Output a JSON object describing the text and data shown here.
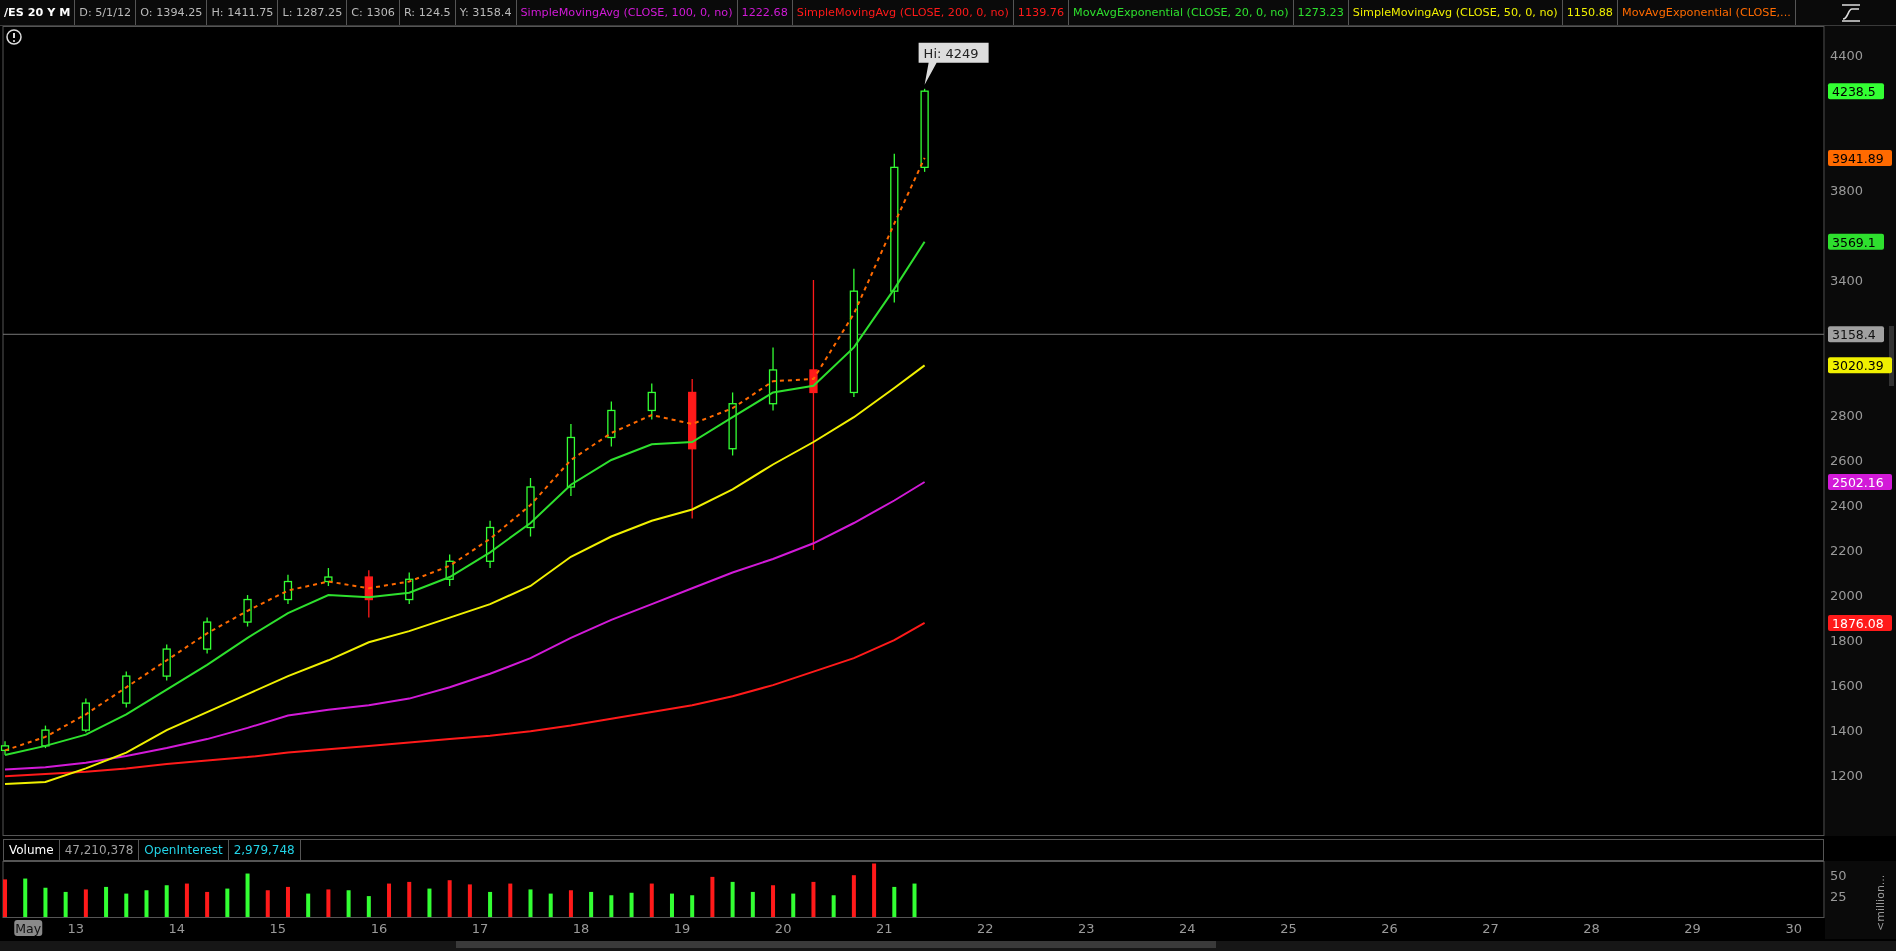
{
  "header": {
    "symbol": "/ES 20 Y M",
    "fields": [
      "D: 5/1/12",
      "O: 1394.25",
      "H: 1411.75",
      "L: 1287.25",
      "C: 1306",
      "R: 124.5",
      "Y: 3158.4"
    ],
    "study_values": [
      "1222.68",
      "1139.76",
      "1273.23",
      "1150.88"
    ]
  },
  "price_chart": {
    "candles": {
      "chart_data": {
        "type": "candlestick",
        "x": [
          12.3,
          12.7,
          13.1,
          13.5,
          13.9,
          14.3,
          14.7,
          15.1,
          15.5,
          15.9,
          16.3,
          16.7,
          17.1,
          17.5,
          17.9,
          18.3,
          18.7,
          19.1,
          19.5,
          19.9,
          20.3,
          20.7,
          21.1,
          21.4
        ],
        "ohlc": [
          [
            1310,
            1350,
            1290,
            1330
          ],
          [
            1330,
            1420,
            1320,
            1400
          ],
          [
            1400,
            1540,
            1390,
            1520
          ],
          [
            1520,
            1660,
            1500,
            1640
          ],
          [
            1640,
            1780,
            1620,
            1760
          ],
          [
            1760,
            1900,
            1740,
            1880
          ],
          [
            1880,
            2000,
            1860,
            1980
          ],
          [
            1980,
            2090,
            1960,
            2060
          ],
          [
            2060,
            2120,
            2040,
            2080
          ],
          [
            2080,
            2110,
            1900,
            1980
          ],
          [
            1980,
            2100,
            1960,
            2070
          ],
          [
            2070,
            2180,
            2040,
            2150
          ],
          [
            2150,
            2330,
            2120,
            2300
          ],
          [
            2300,
            2520,
            2260,
            2480
          ],
          [
            2480,
            2760,
            2440,
            2700
          ],
          [
            2700,
            2860,
            2660,
            2820
          ],
          [
            2820,
            2940,
            2780,
            2900
          ],
          [
            2900,
            2960,
            2340,
            2650
          ],
          [
            2650,
            2900,
            2620,
            2850
          ],
          [
            2850,
            3100,
            2820,
            3000
          ],
          [
            3000,
            3400,
            2200,
            2900
          ],
          [
            2900,
            3450,
            2880,
            3350
          ],
          [
            3350,
            3960,
            3300,
            3900
          ],
          [
            3900,
            4249,
            3880,
            4238.5
          ]
        ],
        "xlim": [
          12.28,
          30.3
        ],
        "ylim": [
          934,
          4528
        ],
        "yticks": [
          1200,
          1400,
          1600,
          1800,
          2000,
          2200,
          2400,
          2600,
          2800,
          3400,
          3800,
          4400
        ],
        "ref_lines": [
          {
            "axis": "y",
            "value": 3158.4,
            "label": "3158.4"
          }
        ],
        "annotations": [
          {
            "x": 21.4,
            "y": 4249,
            "text": "Hi: 4249"
          },
          "4238.5"
        ]
      }
    },
    "averages": {
      "chart_data": {
        "type": "line",
        "x": [
          12.3,
          12.7,
          13.1,
          13.5,
          13.9,
          14.3,
          14.7,
          15.1,
          15.5,
          15.9,
          16.3,
          16.7,
          17.1,
          17.5,
          17.9,
          18.3,
          18.7,
          19.1,
          19.5,
          19.9,
          20.3,
          20.7,
          21.1,
          21.4
        ],
        "series": [
          {
            "name": "SimpleMovingAvg (CLOSE, 100, 0, no)",
            "color": "#d21ad8",
            "line_style": "solid",
            "values": [
              1225,
              1235,
              1255,
              1285,
              1320,
              1360,
              1410,
              1465,
              1490,
              1510,
              1540,
              1590,
              1650,
              1720,
              1810,
              1890,
              1960,
              2030,
              2100,
              2160,
              2230,
              2320,
              2420,
              2502.16
            ]
          },
          {
            "name": "SimpleMovingAvg (CLOSE, 200, 0, no)",
            "color": "#ff1a1a",
            "line_style": "solid",
            "values": [
              1195,
              1205,
              1215,
              1230,
              1250,
              1265,
              1280,
              1300,
              1315,
              1330,
              1345,
              1360,
              1375,
              1395,
              1420,
              1450,
              1480,
              1510,
              1550,
              1600,
              1660,
              1720,
              1800,
              1876.08
            ]
          },
          {
            "name": "MovAvgExponential (CLOSE, 20, 0, no)",
            "color": "#2ee02e",
            "line_style": "solid",
            "values": [
              1290,
              1330,
              1380,
              1470,
              1580,
              1690,
              1810,
              1920,
              2000,
              1990,
              2010,
              2080,
              2190,
              2320,
              2490,
              2600,
              2670,
              2680,
              2790,
              2900,
              2930,
              3100,
              3360,
              3569.1
            ]
          },
          {
            "name": "SimpleMovingAvg (CLOSE, 50, 0, no)",
            "color": "#f0f000",
            "line_style": "solid",
            "values": [
              1160,
              1170,
              1230,
              1300,
              1400,
              1480,
              1560,
              1640,
              1710,
              1790,
              1840,
              1900,
              1960,
              2040,
              2170,
              2260,
              2330,
              2380,
              2470,
              2580,
              2680,
              2790,
              2920,
              3020.39
            ]
          },
          {
            "name": "MovAvgExponential (CLOSE,...",
            "color": "#ff6a00",
            "line_style": "dashed",
            "values": [
              1310,
              1370,
              1470,
              1590,
              1710,
              1830,
              1930,
              2020,
              2060,
              2030,
              2060,
              2130,
              2250,
              2400,
              2600,
              2720,
              2800,
              2760,
              2830,
              2950,
              2960,
              3250,
              3650,
              3941.89
            ]
          }
        ],
        "xlim": [
          12.28,
          30.3
        ],
        "ylim": [
          934,
          4528
        ],
        "annotations": [
          "2502.16",
          "1876.08",
          "3569.1",
          "3020.39",
          "3941.89"
        ]
      }
    }
  },
  "volume_pane": {
    "fields": [
      {
        "text": "Volume",
        "color": "#ffffff"
      },
      {
        "text": "47,210,378",
        "color": "#a0a0a0"
      },
      {
        "text": "OpenInterest",
        "color": "#22d3e6"
      },
      {
        "text": "2,979,748",
        "color": "#22d3e6"
      }
    ],
    "chart_data": {
      "type": "bar",
      "stacked": true,
      "x": [
        12.3,
        12.5,
        12.7,
        12.9,
        13.1,
        13.3,
        13.5,
        13.7,
        13.9,
        14.1,
        14.3,
        14.5,
        14.7,
        14.9,
        15.1,
        15.3,
        15.5,
        15.7,
        15.9,
        16.1,
        16.3,
        16.5,
        16.7,
        16.9,
        17.1,
        17.3,
        17.5,
        17.7,
        17.9,
        18.1,
        18.3,
        18.5,
        18.7,
        18.9,
        19.1,
        19.3,
        19.5,
        19.7,
        19.9,
        20.1,
        20.3,
        20.5,
        20.7,
        20.9,
        21.1,
        21.3
      ],
      "series": [
        {
          "color": "#33ff33",
          "values": [
            null,
            46,
            35,
            30,
            null,
            36,
            28,
            32,
            38,
            null,
            null,
            34,
            52,
            null,
            null,
            28,
            null,
            32,
            25,
            null,
            null,
            34,
            null,
            null,
            30,
            null,
            33,
            28,
            null,
            30,
            26,
            29,
            null,
            28,
            26,
            null,
            42,
            30,
            null,
            28,
            null,
            26,
            null,
            null,
            36,
            40
          ]
        },
        {
          "color": "#ff1a1a",
          "values": [
            45,
            null,
            null,
            null,
            33,
            null,
            null,
            null,
            null,
            40,
            30,
            null,
            null,
            32,
            36,
            null,
            33,
            null,
            null,
            40,
            42,
            null,
            44,
            39,
            null,
            40,
            null,
            null,
            32,
            null,
            null,
            null,
            40,
            null,
            null,
            48,
            null,
            null,
            38,
            null,
            42,
            null,
            50,
            64,
            null,
            null
          ]
        }
      ],
      "xlim": [
        12.28,
        30.3
      ],
      "ylim": [
        0,
        67
      ],
      "yticks": [
        25,
        50
      ],
      "ylabel": "<million...",
      "xticks": [
        {
          "value": 12.53,
          "label": "May"
        },
        13,
        14,
        15,
        16,
        17,
        18,
        19,
        20,
        21,
        22,
        23,
        24,
        25,
        26,
        27,
        28,
        29,
        30
      ]
    }
  }
}
